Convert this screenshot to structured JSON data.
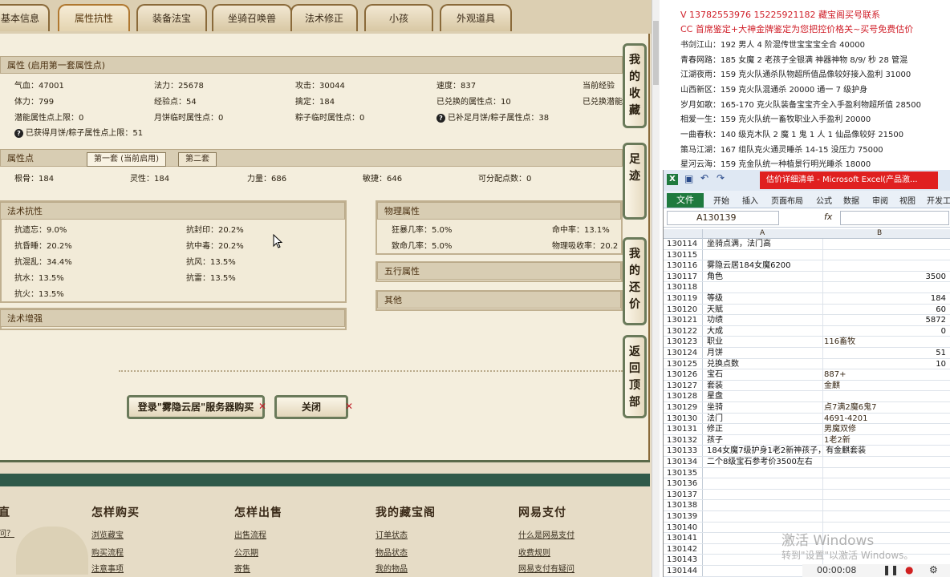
{
  "tabs": [
    "基本信息",
    "属性抗性",
    "装备法宝",
    "坐骑召唤兽",
    "法术修正",
    "小孩",
    "外观道具"
  ],
  "attr_section": {
    "title": "属性 (启用第一套属性点)",
    "rows": [
      [
        "气血：47001",
        "法力：25678",
        "攻击：30044",
        "速度：837",
        "当前经验"
      ],
      [
        "体力：799",
        "经验点：54",
        "擒定：184",
        "已兑换的属性点：10",
        "已兑换潜能"
      ],
      [
        "潜能属性点上限：0",
        "月饼临时属性点：0",
        "粽子临时属性点：0",
        "已补足月饼/粽子属性点：38",
        ""
      ]
    ],
    "note": "已获得月饼/粽子属性点上限：51"
  },
  "points_section": {
    "title": "属性点",
    "subtab1": "第一套 (当前启用)",
    "subtab2": "第二套",
    "values": [
      "根骨：184",
      "灵性：184",
      "力量：686",
      "敏捷：646",
      "可分配点数：0"
    ]
  },
  "resist_section": {
    "title": "法术抗性",
    "left": [
      "抗遗忘：9.0%",
      "抗昏睡：20.2%",
      "抗混乱：34.4%",
      "抗水：13.5%",
      "抗火：13.5%"
    ],
    "right": [
      "抗封印：20.2%",
      "抗中毒：20.2%",
      "抗风：13.5%",
      "抗雷：13.5%"
    ]
  },
  "enhance_title": "法术增强",
  "phys_section": {
    "title": "物理属性",
    "rows": [
      [
        "狂暴几率：5.0%",
        "命中率：13.1%"
      ],
      [
        "致命几率：5.0%",
        "物理吸收率：20.2"
      ]
    ]
  },
  "wuxing_title": "五行属性",
  "other_title": "其他",
  "buttons": {
    "login": "登录\"雾隐云居\"服务器购买",
    "close": "关闭"
  },
  "side_buttons": [
    "我的收藏",
    "足迹",
    "我的还价",
    "返回顶部"
  ],
  "footer": {
    "cols": [
      {
        "title": "怎样购买",
        "links": [
          "浏览藏宝",
          "购买流程",
          "注意事项"
        ]
      },
      {
        "title": "怎样出售",
        "links": [
          "出售流程",
          "公示期",
          "寄售"
        ]
      },
      {
        "title": "我的藏宝阁",
        "links": [
          "订单状态",
          "物品状态",
          "我的物品"
        ]
      },
      {
        "title": "网易支付",
        "links": [
          "什么是网易支付",
          "收费规则",
          "网易支付有疑问"
        ]
      }
    ],
    "left_partial": [
      "直",
      "问？"
    ]
  },
  "right_text": {
    "line1": "V 13782553976    15225921182  藏宝阁买号联系",
    "line2": "CC 首席鉴定+大神金牌鉴定为您把控价格关~买号免费估价",
    "lines": [
      "书剑江山：192 男人 4 阶混传世宝宝宝全合 40000",
      "青春网路：185 女魔 2 老孩子全银满 神器神物 8/9/ 秒 28 管混",
      "江湖夜雨：159 克火队通杀队物超所值品像较好接入盈利 31000",
      "山西新区：159 克火队混通杀 20000 通一 7 级护身",
      "岁月如歌：165-170 克火队装备宝宝齐全入手盈利物超所值 28500",
      "相爱一生：159 克火队统一畜牧职业入手盈利 20000",
      "一曲春秋：140 级克木队 2 魔 1 鬼 1 人 1 仙品像较好 21500",
      "策马江湖：167 组队克火通灵睡杀 14-15 没压力 75000",
      "星河云海：159 克金队统一种植景行明光睡杀 18000"
    ]
  },
  "excel": {
    "title": "估价详细清单 - Microsoft Excel(产品激...",
    "ribbon": [
      "文件",
      "开始",
      "插入",
      "页面布局",
      "公式",
      "数据",
      "审阅",
      "视图",
      "开发工"
    ],
    "namebox": "A130139",
    "fx": "fx",
    "col_a": "A",
    "col_b": "B",
    "rows": [
      [
        "130114",
        "坐骑点满，法门高",
        ""
      ],
      [
        "130115",
        "",
        ""
      ],
      [
        "130116",
        "雾隐云居184女魔6200",
        ""
      ],
      [
        "130117",
        "角色",
        "3500"
      ],
      [
        "130118",
        "",
        ""
      ],
      [
        "130119",
        "等级",
        "184"
      ],
      [
        "130120",
        "天赋",
        "60"
      ],
      [
        "130121",
        "功绩",
        "5872"
      ],
      [
        "130122",
        "大成",
        "0"
      ],
      [
        "130123",
        "职业",
        "116畜牧"
      ],
      [
        "130124",
        "月饼",
        "51"
      ],
      [
        "130125",
        "兑换点数",
        "10"
      ],
      [
        "130126",
        "宝石",
        "887+"
      ],
      [
        "130127",
        "套装",
        "金麒"
      ],
      [
        "130128",
        "星盘",
        ""
      ],
      [
        "130129",
        "坐骑",
        "点7满2魔6鬼7"
      ],
      [
        "130130",
        "法门",
        "4691-4201"
      ],
      [
        "130131",
        "修正",
        "男魔双修"
      ],
      [
        "130132",
        "孩子",
        "1老2新"
      ],
      [
        "130133",
        "184女魔7级护身1老2新神孩子，有金麒套装",
        ""
      ],
      [
        "130134",
        "二个8级宝石参考价3500左右",
        ""
      ],
      [
        "130135",
        "",
        ""
      ],
      [
        "130136",
        "",
        ""
      ],
      [
        "130137",
        "",
        ""
      ],
      [
        "130138",
        "",
        ""
      ],
      [
        "130139",
        "",
        ""
      ],
      [
        "130140",
        "",
        ""
      ],
      [
        "130141",
        "",
        ""
      ],
      [
        "130142",
        "",
        ""
      ],
      [
        "130143",
        "",
        ""
      ],
      [
        "130144",
        "",
        ""
      ]
    ]
  },
  "watermark": {
    "line1": "激活 Windows",
    "line2": "转到\"设置\"以激活 Windows。"
  },
  "recorder": {
    "time": "00:00:08"
  }
}
